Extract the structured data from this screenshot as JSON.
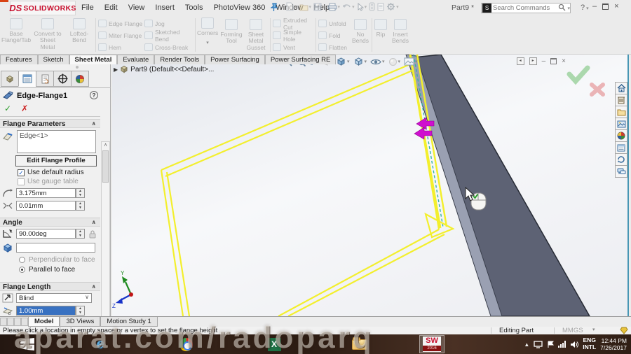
{
  "app": {
    "logo_mark": "DS",
    "logo_text": "SOLIDWORKS",
    "doc_title": "Part9 *",
    "search_placeholder": "Search Commands"
  },
  "menu": [
    "File",
    "Edit",
    "View",
    "Insert",
    "Tools",
    "PhotoView 360",
    "Window",
    "Help"
  ],
  "ribbon": {
    "big": [
      "Base Flange/Tab",
      "Convert to Sheet Metal",
      "Lofted-Bend"
    ],
    "col1": [
      "Edge Flange",
      "Miter Flange",
      "Hem"
    ],
    "col2": [
      "Jog",
      "Sketched Bend",
      "Cross-Break"
    ],
    "corners": "Corners",
    "forming_tool": "Forming Tool",
    "gusset": "Sheet Metal Gusset",
    "col3": [
      "Extruded Cut",
      "Simple Hole",
      "Vent"
    ],
    "col4": [
      "Unfold",
      "Fold",
      "Flatten"
    ],
    "no_bends": "No Bends",
    "rip": "Rip",
    "insert_bends": "Insert Bends"
  },
  "tabs": [
    "Features",
    "Sketch",
    "Sheet Metal",
    "Evaluate",
    "Render Tools",
    "Power Surfacing",
    "Power Surfacing RE"
  ],
  "active_tab": "Sheet Metal",
  "feature_tree": {
    "root": "Part9 (Default<<Default>..."
  },
  "property_manager": {
    "title": "Edge-Flange1",
    "flange_parameters": {
      "header": "Flange Parameters",
      "selected_edge": "Edge<1>",
      "edit_profile": "Edit Flange Profile",
      "use_default_radius": "Use default radius",
      "use_gauge_table": "Use gauge table",
      "bend_radius": "3.175mm",
      "gap_distance": "0.01mm"
    },
    "angle": {
      "header": "Angle",
      "flange_angle": "90.00deg",
      "face_reference": "",
      "perpendicular": "Perpendicular to face",
      "parallel": "Parallel to face"
    },
    "flange_length": {
      "header": "Flange Length",
      "end_condition": "Blind",
      "length": "1.00mm"
    }
  },
  "doc_tabs": [
    "Model",
    "3D Views",
    "Motion Study 1"
  ],
  "active_doc_tab": "Model",
  "status": {
    "message": "Please click a location in empty space or a vertex to set the flange height",
    "mode": "Editing Part",
    "units": "MMGS"
  },
  "tray": {
    "lang": "ENG",
    "layout": "INTL",
    "time": "12:44 PM",
    "date": "7/26/2017"
  },
  "watermark": "aparat.com/radoparq",
  "icons": {
    "hud": [
      "zoom-to-fit",
      "zoom-to-area",
      "previous-view",
      "section-view",
      "view-orientation",
      "display-style",
      "hide-show-items",
      "appearances",
      "apply-scene"
    ],
    "task_pane": [
      "solidworks-resources",
      "design-library",
      "file-explorer",
      "view-palette",
      "appearances-scenes",
      "custom-properties",
      "solidworks-forum",
      "comments"
    ],
    "taskbar": [
      "start",
      "internet-explorer",
      "chrome",
      "excel",
      "file-explorer",
      "solidworks-2016"
    ]
  },
  "colors": {
    "highlight_yellow": "#f3ef2d",
    "part_face": "#5d6274",
    "part_edge": "#9aa0b2",
    "direction_arrow": "#cf10cf",
    "confirm_green": "#98cf9a",
    "cancel_red": "#e9a9ab",
    "selection_blue": "#3871c1",
    "logo_red": "#c8102e"
  }
}
